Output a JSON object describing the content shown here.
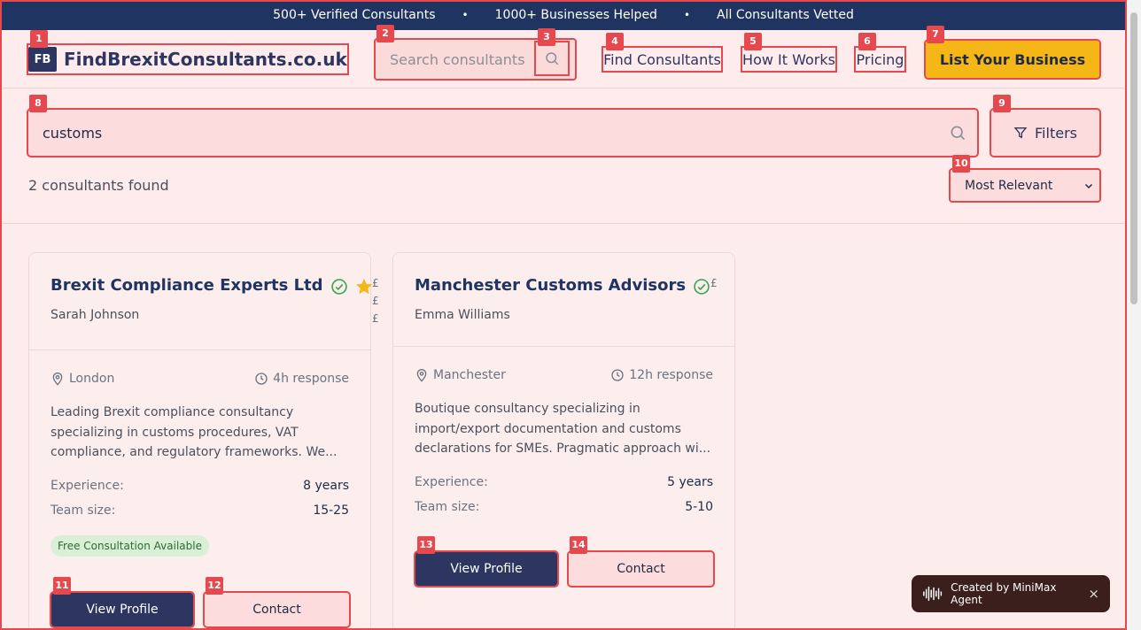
{
  "topbar": {
    "items": [
      "500+ Verified Consultants",
      "1000+ Businesses Helped",
      "All Consultants Vetted"
    ],
    "separator": "•"
  },
  "header": {
    "logo_mark": "FB",
    "logo_text": "FindBrexitConsultants.co.uk",
    "search_placeholder": "Search consultants",
    "nav": [
      "Find Consultants",
      "How It Works",
      "Pricing"
    ],
    "cta": "List Your Business"
  },
  "search": {
    "query": "customs",
    "filters_label": "Filters",
    "result_count": "2 consultants found",
    "sort_selected": "Most Relevant"
  },
  "cards": [
    {
      "name": "Brexit Compliance Experts Ltd",
      "person": "Sarah Johnson",
      "price": "£\n£\n£",
      "location": "London",
      "response": "4h response",
      "description": "Leading Brexit compliance consultancy specializing in customs procedures, VAT compliance, and regulatory frameworks. We...",
      "experience_label": "Experience:",
      "experience": "8 years",
      "team_label": "Team size:",
      "team": "15-25",
      "badge": "Free Consultation Available",
      "view_label": "View Profile",
      "contact_label": "Contact"
    },
    {
      "name": "Manchester Customs Advisors",
      "person": "Emma Williams",
      "price": "£",
      "location": "Manchester",
      "response": "12h response",
      "description": "Boutique consultancy specializing in import/export documentation and customs declarations for SMEs. Pragmatic approach wi...",
      "experience_label": "Experience:",
      "experience": "5 years",
      "team_label": "Team size:",
      "team": "5-10",
      "view_label": "View Profile",
      "contact_label": "Contact"
    }
  ],
  "toast": {
    "text": "Created by MiniMax Agent",
    "close": "×"
  },
  "badges": [
    "1",
    "2",
    "3",
    "4",
    "5",
    "6",
    "7",
    "8",
    "9",
    "10",
    "11",
    "12",
    "13",
    "14"
  ],
  "colors": {
    "navy": "#1f3461",
    "accent": "#f5b617",
    "annotation": "#e5484d",
    "verified": "#3aa657"
  }
}
